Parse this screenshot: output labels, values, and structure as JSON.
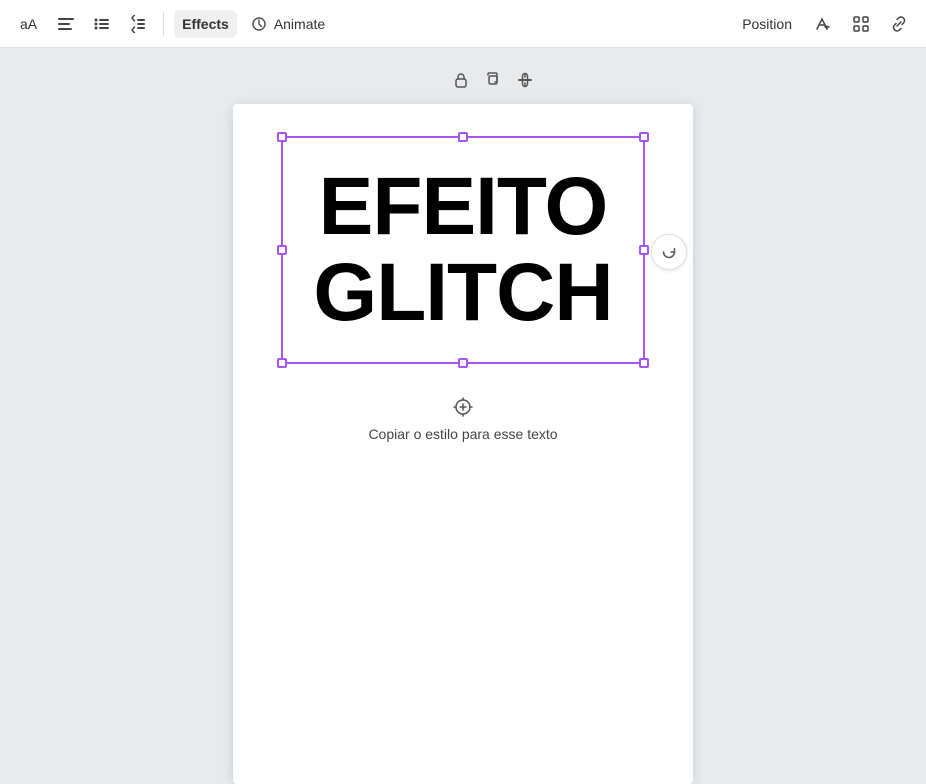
{
  "toolbar": {
    "font_size_label": "aA",
    "align_left_label": "≡",
    "list_label": "☰",
    "line_spacing_label": "⇕",
    "effects_label": "Effects",
    "animate_label": "Animate",
    "position_label": "Position"
  },
  "canvas": {
    "lock_tooltip": "Lock",
    "duplicate_tooltip": "Duplicate",
    "more_tooltip": "More",
    "refresh_tooltip": "Refresh style"
  },
  "text_element": {
    "line1": "EFEITO",
    "line2": "GLITCH"
  },
  "copy_style": {
    "label": "Copiar o estilo para esse texto"
  }
}
